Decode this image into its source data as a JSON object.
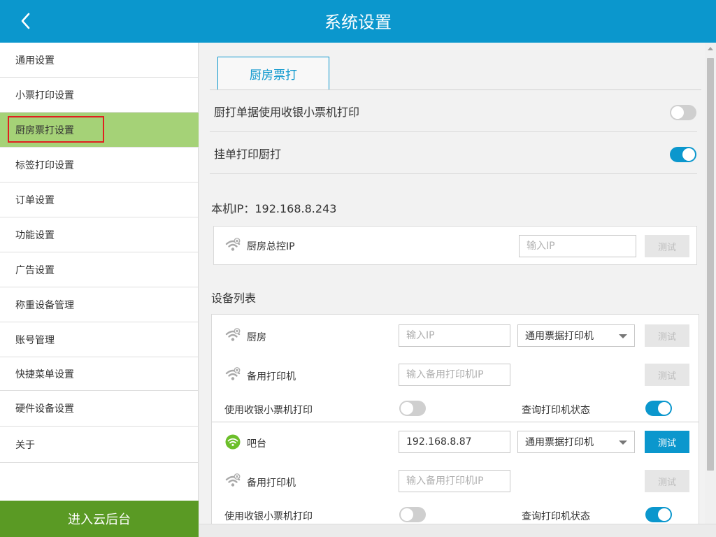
{
  "header": {
    "title": "系统设置",
    "back_icon": "chevron-left-icon"
  },
  "sidebar": {
    "items": [
      {
        "label": "通用设置"
      },
      {
        "label": "小票打印设置"
      },
      {
        "label": "厨房票打设置",
        "active": true
      },
      {
        "label": "标签打印设置"
      },
      {
        "label": "订单设置"
      },
      {
        "label": "功能设置"
      },
      {
        "label": "广告设置"
      },
      {
        "label": "称重设备管理"
      },
      {
        "label": "账号管理"
      },
      {
        "label": "快捷菜单设置"
      },
      {
        "label": "硬件设备设置"
      },
      {
        "label": "关于"
      }
    ],
    "cloud_button": "进入云后台"
  },
  "main": {
    "tab": "厨房票打",
    "settings": [
      {
        "label": "厨打单据使用收银小票机打印",
        "enabled": false
      },
      {
        "label": "挂单打印厨打",
        "enabled": true
      }
    ],
    "local_ip_label": "本机IP：192.168.8.243",
    "master": {
      "name": "厨房总控IP",
      "ip_placeholder": "输入IP",
      "test_label": "测试",
      "status": "disconnected"
    },
    "device_list_title": "设备列表",
    "devices": [
      {
        "name": "厨房",
        "status": "disconnected",
        "ip": "",
        "ip_placeholder": "输入IP",
        "printer_type": "通用票据打印机",
        "test_label": "测试",
        "test_enabled": false,
        "backup": {
          "name": "备用打印机",
          "ip_placeholder": "输入备用打印机IP",
          "test_label": "测试",
          "status": "disconnected"
        },
        "use_receipt_label": "使用收银小票机打印",
        "use_receipt": false,
        "query_status_label": "查询打印机状态",
        "query_status": true
      },
      {
        "name": "吧台",
        "status": "connected",
        "ip": "192.168.8.87",
        "ip_placeholder": "输入IP",
        "printer_type": "通用票据打印机",
        "test_label": "测试",
        "test_enabled": true,
        "backup": {
          "name": "备用打印机",
          "ip_placeholder": "输入备用打印机IP",
          "test_label": "测试",
          "status": "disconnected"
        },
        "use_receipt_label": "使用收银小票机打印",
        "use_receipt": false,
        "query_status_label": "查询打印机状态",
        "query_status": true
      }
    ]
  },
  "colors": {
    "header": "#0b97cd",
    "active_item": "#a5d277",
    "cloud_button": "#5a9a24",
    "toggle_on": "#0b97cd",
    "toggle_off": "#cfcfcf",
    "wifi_connected": "#6cbf2a",
    "wifi_disconnected": "#a9a9a9"
  }
}
